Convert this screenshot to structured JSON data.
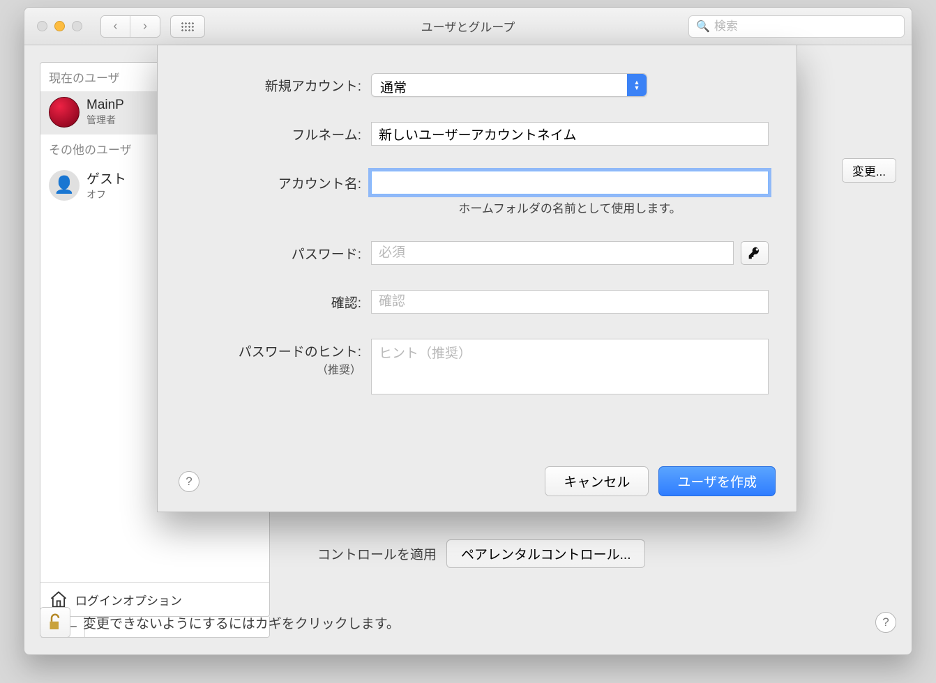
{
  "window": {
    "title": "ユーザとグループ"
  },
  "search": {
    "placeholder": "検索"
  },
  "sidebar": {
    "current_header": "現在のユーザ",
    "current_user": {
      "name": "MainP",
      "role": "管理者"
    },
    "other_header": "その他のユーザ",
    "guest": {
      "name": "ゲスト",
      "status": "オフ"
    },
    "login_options": "ログインオプション"
  },
  "right": {
    "change_button": "変更...",
    "parental_label": "コントロールを適用",
    "parental_button": "ペアレンタルコントロール..."
  },
  "footer": {
    "lock_text": "変更できないようにするにはカギをクリックします。"
  },
  "sheet": {
    "account_type_label": "新規アカウント:",
    "account_type_value": "通常",
    "fullname_label": "フルネーム:",
    "fullname_value": "新しいユーザーアカウントネイム",
    "accountname_label": "アカウント名:",
    "accountname_value": "",
    "accountname_hint": "ホームフォルダの名前として使用します。",
    "password_label": "パスワード:",
    "password_placeholder": "必須",
    "verify_label": "確認:",
    "verify_placeholder": "確認",
    "hint_label": "パスワードのヒント:",
    "hint_sublabel": "（推奨）",
    "hint_placeholder": "ヒント（推奨）",
    "cancel": "キャンセル",
    "create": "ユーザを作成"
  }
}
